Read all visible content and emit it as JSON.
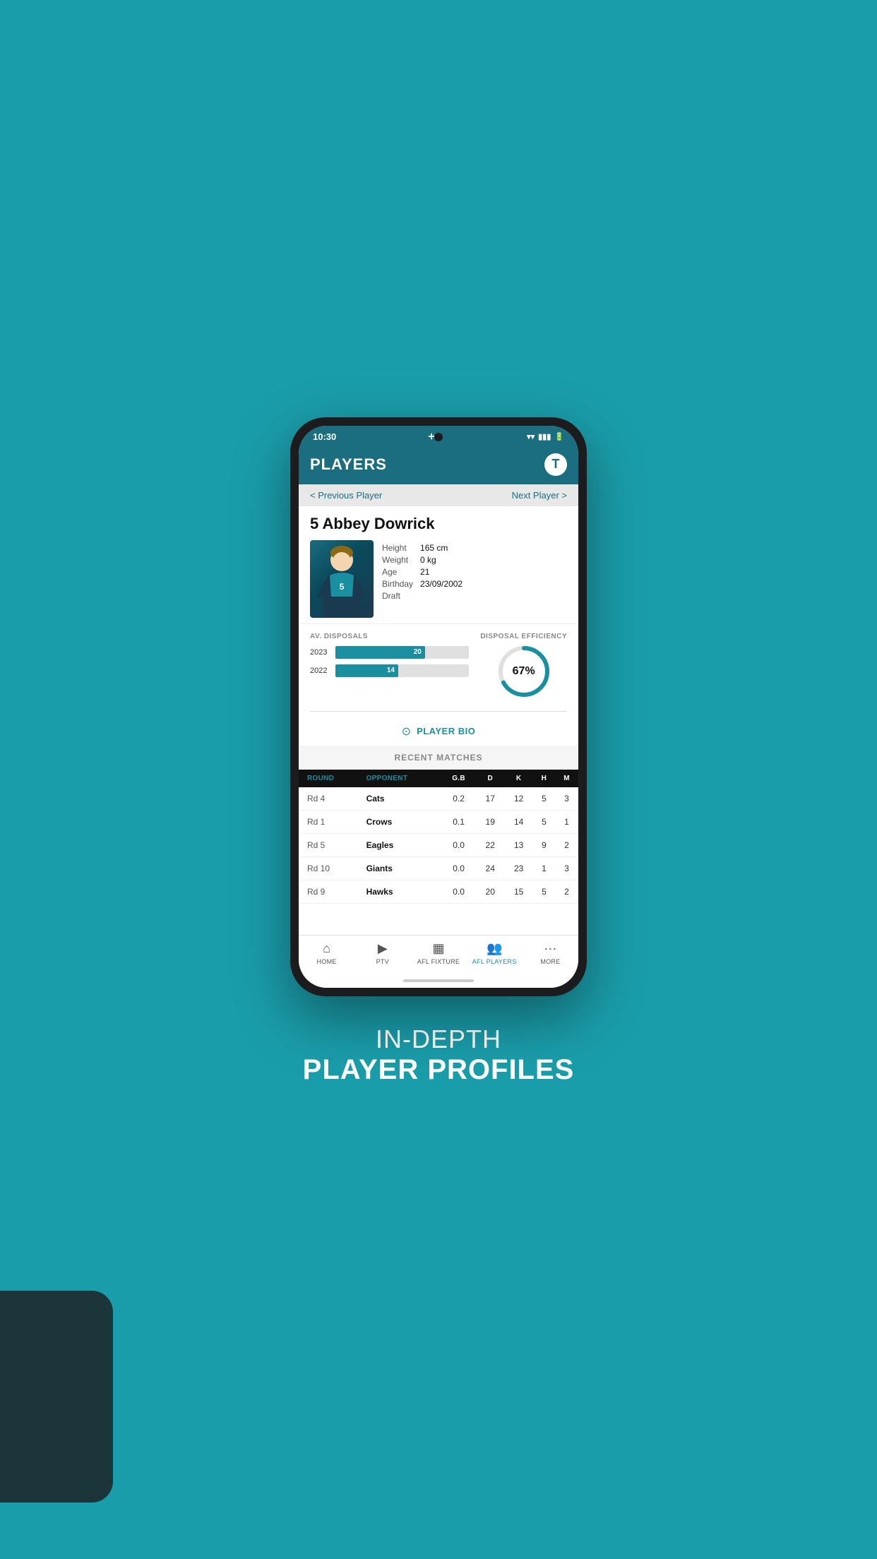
{
  "background_color": "#1a9daa",
  "status_bar": {
    "time": "10:30",
    "wifi_icon": "wifi",
    "signal_icon": "signal",
    "battery_icon": "battery"
  },
  "header": {
    "title": "PLAYERS",
    "logo_letter": "T"
  },
  "player_nav": {
    "prev_label": "< Previous Player",
    "next_label": "Next Player >"
  },
  "player": {
    "number": "5",
    "name": "Abbey Dowrick",
    "height_label": "Height",
    "height_value": "165 cm",
    "weight_label": "Weight",
    "weight_value": "0 kg",
    "age_label": "Age",
    "age_value": "21",
    "birthday_label": "Birthday",
    "birthday_value": "23/09/2002",
    "draft_label": "Draft",
    "draft_value": ""
  },
  "stats": {
    "av_disposals_label": "AV. DISPOSALS",
    "disposal_efficiency_label": "DISPOSAL EFFICIENCY",
    "years": [
      {
        "year": "2023",
        "value": 20,
        "max": 30
      },
      {
        "year": "2022",
        "value": 14,
        "max": 30
      }
    ],
    "efficiency_percent": 67,
    "efficiency_display": "67%"
  },
  "player_bio": {
    "label": "PLAYER BIO",
    "icon": "person-circle"
  },
  "recent_matches": {
    "title": "RECENT MATCHES",
    "columns": [
      "ROUND",
      "OPPONENT",
      "G.B",
      "D",
      "K",
      "H",
      "M"
    ],
    "rows": [
      {
        "round": "Rd 4",
        "opponent": "Cats",
        "gb": "0.2",
        "d": "17",
        "k": "12",
        "h": "5",
        "m": "3"
      },
      {
        "round": "Rd 1",
        "opponent": "Crows",
        "gb": "0.1",
        "d": "19",
        "k": "14",
        "h": "5",
        "m": "1"
      },
      {
        "round": "Rd 5",
        "opponent": "Eagles",
        "gb": "0.0",
        "d": "22",
        "k": "13",
        "h": "9",
        "m": "2"
      },
      {
        "round": "Rd 10",
        "opponent": "Giants",
        "gb": "0.0",
        "d": "24",
        "k": "23",
        "h": "1",
        "m": "3"
      },
      {
        "round": "Rd 9",
        "opponent": "Hawks",
        "gb": "0.0",
        "d": "20",
        "k": "15",
        "h": "5",
        "m": "2"
      }
    ]
  },
  "bottom_nav": {
    "items": [
      {
        "id": "home",
        "label": "HOME",
        "icon": "⌂",
        "active": false
      },
      {
        "id": "ptv",
        "label": "PTV",
        "icon": "▶",
        "active": false
      },
      {
        "id": "afl-fixture",
        "label": "AFL FIXTURE",
        "icon": "📋",
        "active": false
      },
      {
        "id": "afl-players",
        "label": "AFL PLAYERS",
        "icon": "👥",
        "active": true
      },
      {
        "id": "more",
        "label": "MORE",
        "icon": "•••",
        "active": false
      }
    ]
  },
  "promo_text": {
    "line1": "IN-DEPTH",
    "line2": "PLAYER PROFILES"
  }
}
